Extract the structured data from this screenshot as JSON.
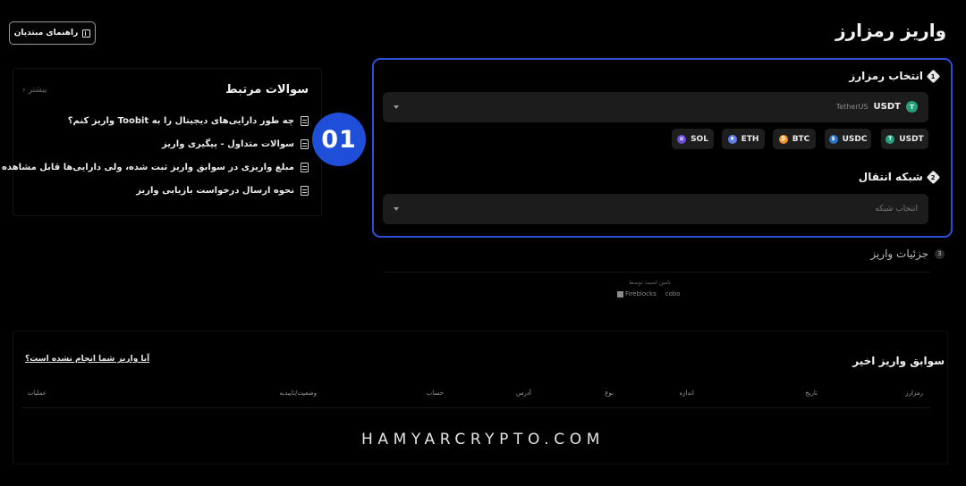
{
  "header": {
    "title": "واریز رمزارز",
    "guide_label": "راهنمای مبتدیان"
  },
  "faq": {
    "title": "سوالات مرتبط",
    "more_label": "بیشتر",
    "items": [
      "چه طور دارایی‌های دیجیتال را به Toobit واریز کنم؟",
      "سوالات متداول - پیگیری واریز",
      "مبلغ واریزی در سوابق واریز ثبت شده، ولی دارایی‌ها قابل مشاهده نیستند؟",
      "نحوه ارسال درخواست بازیابی واریز"
    ]
  },
  "step_badge": "01",
  "coin_section": {
    "step_number": "1",
    "label": "انتخاب رمزارز",
    "selected": {
      "symbol": "USDT",
      "name": "TetherUS",
      "icon_letter": "T",
      "color": "#26a17b"
    },
    "chips": [
      {
        "symbol": "USDT",
        "icon_letter": "T",
        "color": "#26a17b"
      },
      {
        "symbol": "USDC",
        "icon_letter": "$",
        "color": "#2775ca"
      },
      {
        "symbol": "BTC",
        "icon_letter": "₿",
        "color": "#f7931a"
      },
      {
        "symbol": "ETH",
        "icon_letter": "♦",
        "color": "#627eea"
      },
      {
        "symbol": "SOL",
        "icon_letter": "≡",
        "color": "#6b4fd8"
      }
    ]
  },
  "network_section": {
    "step_number": "2",
    "label": "شبکه انتقال",
    "placeholder": "انتخاب شبکه"
  },
  "details_section": {
    "step_number": "3",
    "label": "جزئیات واریز"
  },
  "security": {
    "note": "تامین امنیت توسط",
    "partners": [
      "Fireblocks",
      "cobo"
    ]
  },
  "history": {
    "title": "سوابق واریز اخیر",
    "help_link": "آیا واریز شما انجام نشده است؟",
    "columns": [
      "رمزارز",
      "تاریخ",
      "اندازه",
      "نوع",
      "آدرس",
      "حساب",
      "وضعیت/تاییدیه",
      "عملیات"
    ]
  },
  "footer": {
    "brand": "HAMYARCRYPTO.COM"
  }
}
